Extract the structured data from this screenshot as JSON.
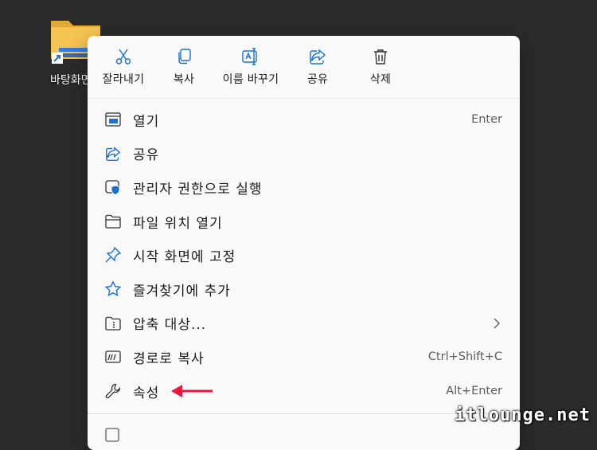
{
  "desktop": {
    "icon_label": "바탕화면"
  },
  "quick_actions": [
    {
      "label": "잘라내기",
      "icon": "scissors-icon"
    },
    {
      "label": "복사",
      "icon": "copy-icon"
    },
    {
      "label": "이름 바꾸기",
      "icon": "rename-icon"
    },
    {
      "label": "공유",
      "icon": "share-icon"
    },
    {
      "label": "삭제",
      "icon": "trash-icon"
    }
  ],
  "menu_items": [
    {
      "label": "열기",
      "shortcut": "Enter",
      "icon": "open-window-icon"
    },
    {
      "label": "공유",
      "shortcut": "",
      "icon": "share-icon"
    },
    {
      "label": "관리자 권한으로 실행",
      "shortcut": "",
      "icon": "admin-shield-icon"
    },
    {
      "label": "파일 위치 열기",
      "shortcut": "",
      "icon": "folder-icon"
    },
    {
      "label": "시작 화면에 고정",
      "shortcut": "",
      "icon": "pin-icon"
    },
    {
      "label": "즐겨찾기에 추가",
      "shortcut": "",
      "icon": "star-icon"
    },
    {
      "label": "압축 대상...",
      "shortcut": "",
      "icon": "zip-folder-icon",
      "submenu": true
    },
    {
      "label": "경로로 복사",
      "shortcut": "Ctrl+Shift+C",
      "icon": "copy-path-icon"
    },
    {
      "label": "속성",
      "shortcut": "Alt+Enter",
      "icon": "wrench-icon"
    }
  ],
  "colors": {
    "accent": "#1b6fd1",
    "annotation": "#e8173f",
    "menu_bg": "#f9f9f9",
    "desktop_bg": "#2b2b2b"
  },
  "watermark": "itlounge.net"
}
